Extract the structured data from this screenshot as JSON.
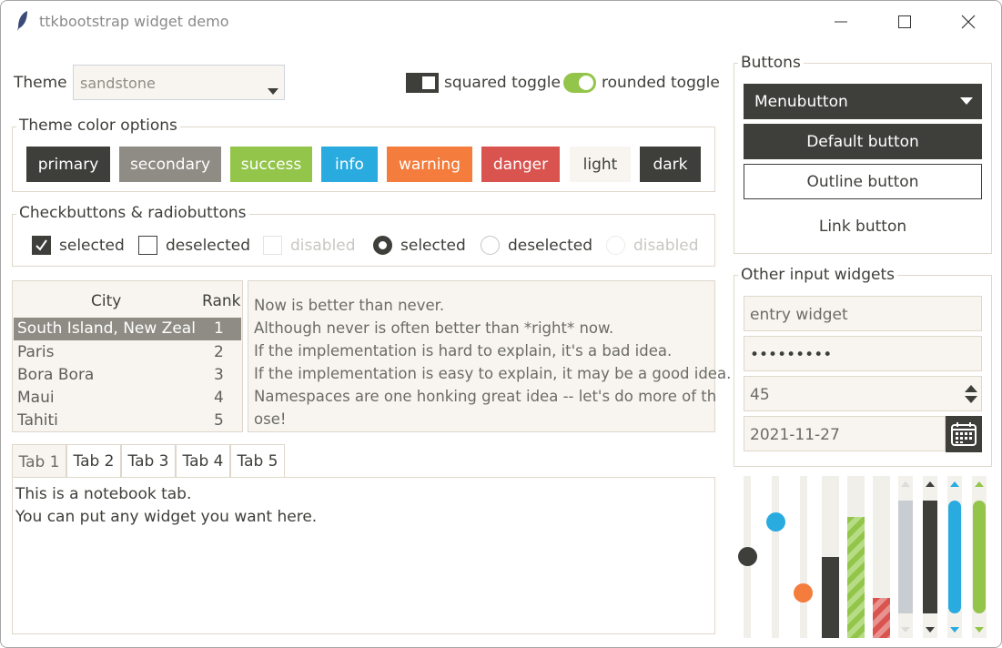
{
  "window": {
    "title": "ttkbootstrap widget demo"
  },
  "theme": {
    "label": "Theme",
    "value": "sandstone"
  },
  "toggles": {
    "squared": "squared toggle",
    "rounded": "rounded toggle"
  },
  "color_options": {
    "title": "Theme color options",
    "buttons": [
      {
        "label": "primary",
        "color": "#3e3f3a"
      },
      {
        "label": "secondary",
        "color": "#8e8c84"
      },
      {
        "label": "success",
        "color": "#93c54b"
      },
      {
        "label": "info",
        "color": "#29abe0"
      },
      {
        "label": "warning",
        "color": "#f47c3c"
      },
      {
        "label": "danger",
        "color": "#d9534f"
      },
      {
        "label": "light",
        "color": "#f8f5f0"
      },
      {
        "label": "dark",
        "color": "#3e3f3a"
      }
    ]
  },
  "checks": {
    "title": "Checkbuttons & radiobuttons",
    "items": [
      "selected",
      "deselected",
      "disabled",
      "selected",
      "deselected",
      "disabled"
    ]
  },
  "table": {
    "headers": [
      "City",
      "Rank"
    ],
    "rows": [
      {
        "city": "South Island, New Zealand",
        "rank": "1"
      },
      {
        "city": "Paris",
        "rank": "2"
      },
      {
        "city": "Bora Bora",
        "rank": "3"
      },
      {
        "city": "Maui",
        "rank": "4"
      },
      {
        "city": "Tahiti",
        "rank": "5"
      }
    ]
  },
  "text": {
    "lines": [
      "Now is better than never.",
      "Although never is often better than *right* now.",
      "If the implementation is hard to explain, it's a bad idea.",
      "If the implementation is easy to explain, it may be a good idea.",
      "Namespaces are one honking great idea -- let's do more of th",
      "ose!"
    ]
  },
  "notebook": {
    "tabs": [
      "Tab 1",
      "Tab 2",
      "Tab 3",
      "Tab 4",
      "Tab 5"
    ],
    "content": [
      "This is a notebook tab.",
      "You can put any widget you want here."
    ]
  },
  "buttons": {
    "title": "Buttons",
    "menubutton": "Menubutton",
    "default": "Default button",
    "outline": "Outline button",
    "link": "Link button"
  },
  "inputs": {
    "title": "Other input widgets",
    "entry": "entry widget",
    "password": "•••••••••",
    "spinbox": "45",
    "date": "2021-11-27"
  },
  "controls": {
    "scale_values": [
      0.5,
      0.72,
      0.28
    ],
    "progress_values": [
      0.5,
      0.75,
      0.25
    ],
    "scrollbar_colors": [
      "#c8cdd2",
      "#3e3f3a",
      "#29abe0",
      "#93c54b"
    ],
    "colors": {
      "dark": "#3e3f3a",
      "info": "#29abe0",
      "warning": "#f47c3c",
      "success": "#93c54b",
      "danger": "#d9534f"
    }
  }
}
